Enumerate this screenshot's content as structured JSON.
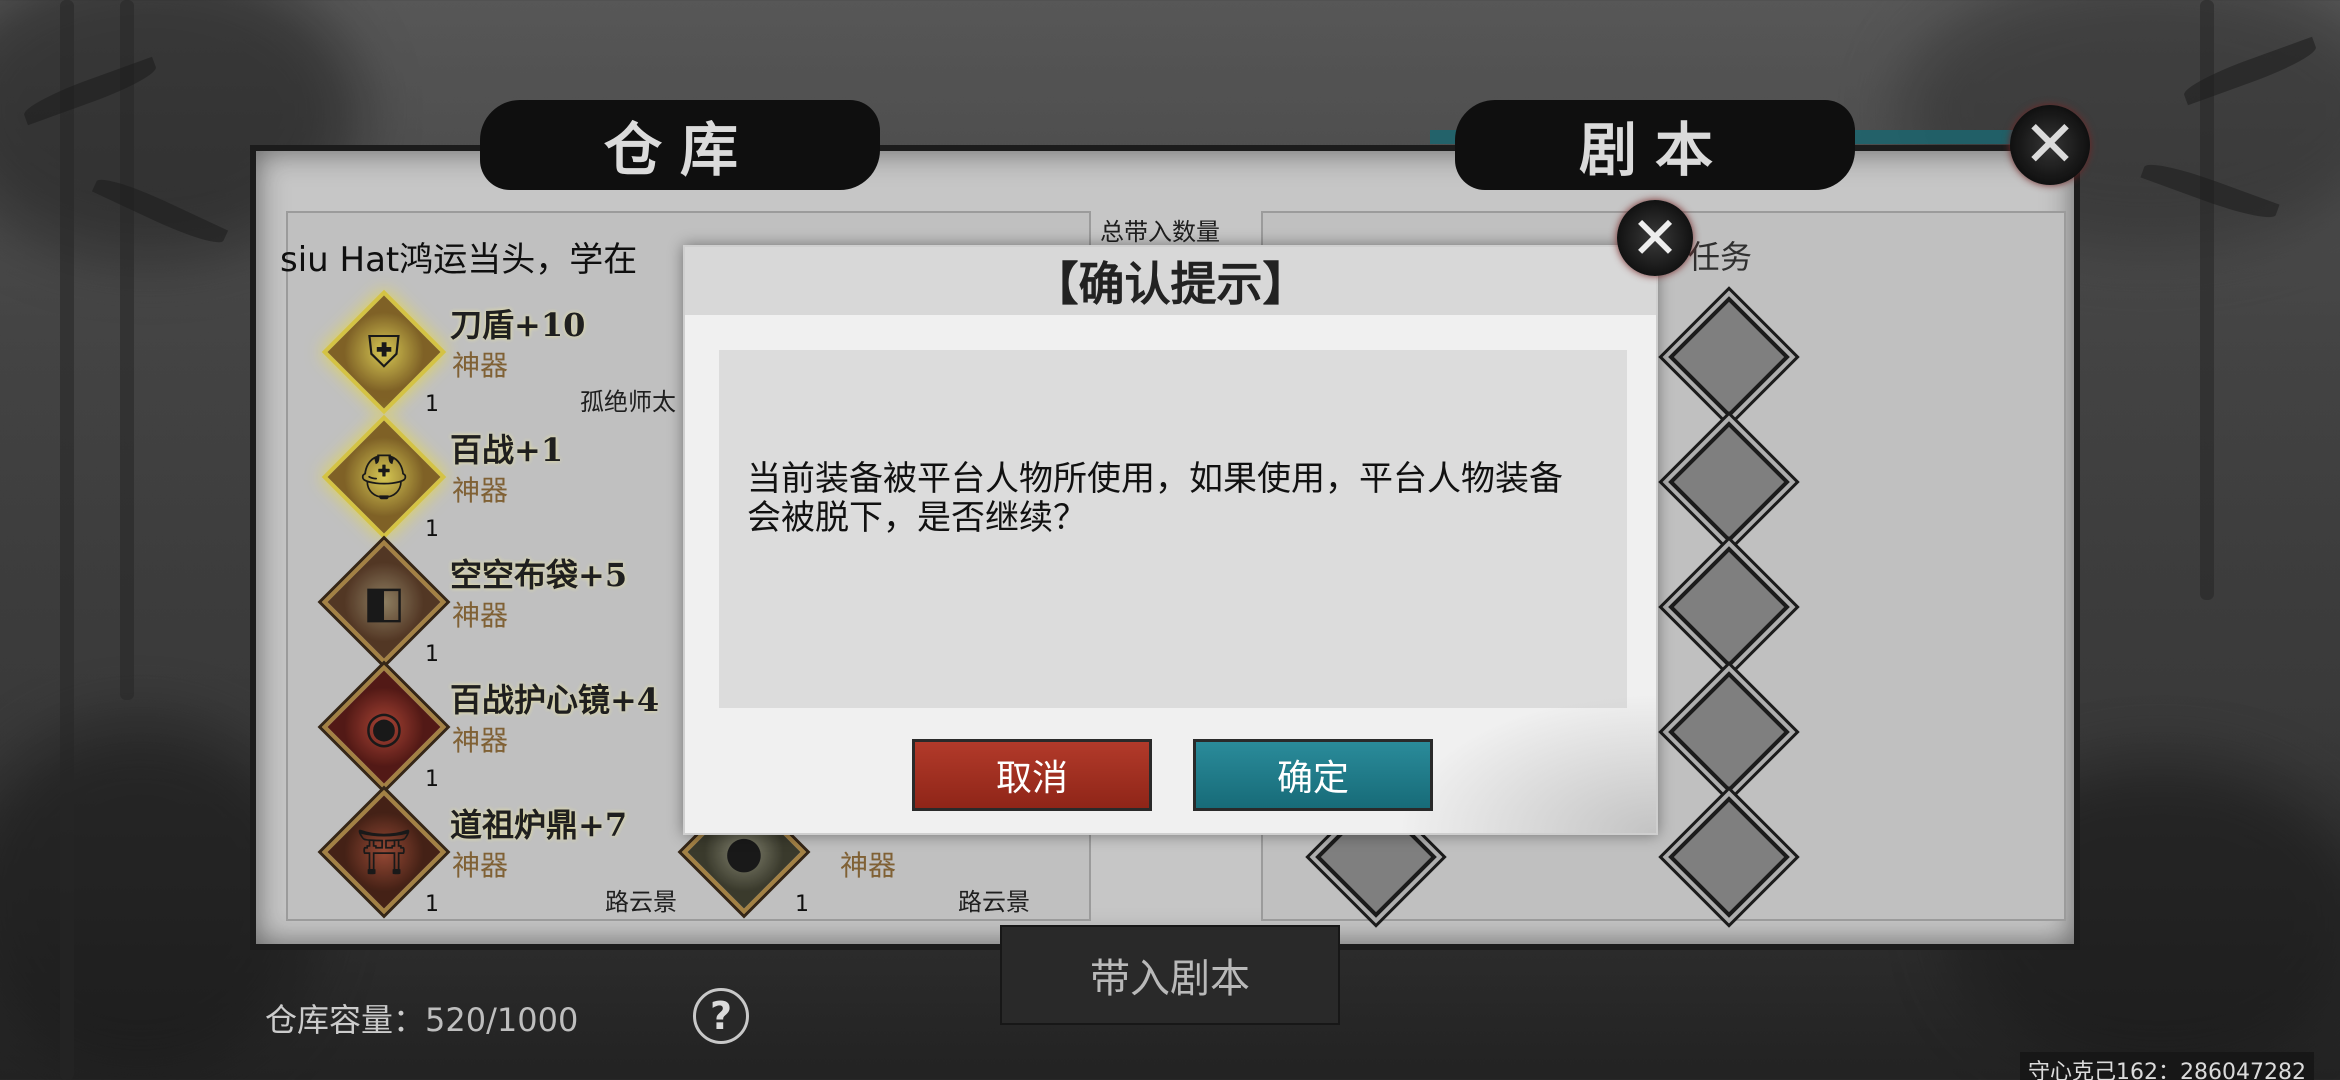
{
  "tabs": {
    "warehouse": "仓库",
    "script": "剧本"
  },
  "header": {
    "total_label": "总带入数量",
    "scroll_text": "siu Hat鸿运当头，学在",
    "task_label": "任务"
  },
  "items": [
    {
      "name": "刀盾+10",
      "type": "神器",
      "count": "1",
      "owner": "孤绝师太",
      "icon": "shield-icon",
      "glow": true
    },
    {
      "name": "百战+1",
      "type": "神器",
      "count": "1",
      "owner": "",
      "icon": "helmet-icon",
      "glow": true
    },
    {
      "name": "空空布袋+5",
      "type": "神器",
      "count": "1",
      "owner": "",
      "icon": "bag-icon",
      "glow": false
    },
    {
      "name": "百战护心镜+4",
      "type": "神器",
      "count": "1",
      "owner": "",
      "icon": "mirror-icon",
      "glow": false
    },
    {
      "name": "道祖炉鼎+7",
      "type": "神器",
      "count": "1",
      "owner": "路云景",
      "icon": "cauldron-icon",
      "glow": false
    }
  ],
  "partial_item": {
    "type": "神器",
    "count": "1",
    "owner": "路云景"
  },
  "bottom": {
    "bring_button": "带入剧本",
    "capacity_label": "仓库容量：",
    "capacity_value": "520/1000",
    "help": "?",
    "footer_id": "守心克己162：286047282"
  },
  "dialog": {
    "title": "【确认提示】",
    "message": "当前装备被平台人物所使用，如果使用，平台人物装备会被脱下，是否继续？",
    "cancel": "取消",
    "confirm": "确定"
  }
}
